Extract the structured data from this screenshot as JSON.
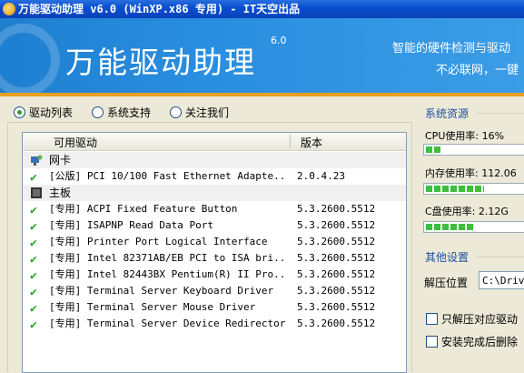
{
  "window": {
    "title": "万能驱动助理 v6.0 (WinXP.x86 专用) - IT天空出品"
  },
  "banner": {
    "product_name": "万能驱动助理",
    "version": "6.0",
    "slogan_line1": "智能的硬件检测与驱动",
    "slogan_line2": "不必联网，一键"
  },
  "tabs": [
    {
      "label": "驱动列表",
      "selected": true
    },
    {
      "label": "系统支持",
      "selected": false
    },
    {
      "label": "关注我们",
      "selected": false
    }
  ],
  "driver_list": {
    "columns": [
      "可用驱动",
      "版本"
    ],
    "rows": [
      {
        "type": "category",
        "icon": "network-card-icon",
        "name": "网卡",
        "version": ""
      },
      {
        "type": "driver",
        "icon": "check-icon",
        "name": "[公版] PCI 10/100 Fast Ethernet Adapte...",
        "version": "2.0.4.23"
      },
      {
        "type": "category",
        "icon": "motherboard-icon",
        "name": "主板",
        "version": ""
      },
      {
        "type": "driver",
        "icon": "check-icon",
        "name": "[专用] ACPI Fixed Feature Button",
        "version": "5.3.2600.5512"
      },
      {
        "type": "driver",
        "icon": "check-icon",
        "name": "[专用] ISAPNP Read Data Port",
        "version": "5.3.2600.5512"
      },
      {
        "type": "driver",
        "icon": "check-icon",
        "name": "[专用] Printer Port Logical Interface",
        "version": "5.3.2600.5512"
      },
      {
        "type": "driver",
        "icon": "check-icon",
        "name": "[专用] Intel 82371AB/EB PCI to ISA bri...",
        "version": "5.3.2600.5512"
      },
      {
        "type": "driver",
        "icon": "check-icon",
        "name": "[专用] Intel 82443BX Pentium(R) II Pro...",
        "version": "5.3.2600.5512"
      },
      {
        "type": "driver",
        "icon": "check-icon",
        "name": "[专用] Terminal Server Keyboard Driver",
        "version": "5.3.2600.5512"
      },
      {
        "type": "driver",
        "icon": "check-icon",
        "name": "[专用] Terminal Server Mouse Driver",
        "version": "5.3.2600.5512"
      },
      {
        "type": "driver",
        "icon": "check-icon",
        "name": "[专用] Terminal Server Device Redirector",
        "version": "5.3.2600.5512"
      }
    ]
  },
  "system_resources": {
    "title": "系统资源",
    "cpu": {
      "label": "CPU使用率:  16%",
      "percent": 16
    },
    "memory": {
      "label": "内存使用率: 112.06",
      "percent": 60
    },
    "disk": {
      "label": "C盘使用率:  2.12G",
      "percent": 50
    }
  },
  "other_settings": {
    "title": "其他设置",
    "extract_label": "解压位置",
    "extract_value": "C:\\Drive",
    "option1": "只解压对应驱动",
    "option2": "安装完成后删除"
  },
  "colors": {
    "banner": "#2a8ee0",
    "titlebar": "#0a4fd0",
    "accent_line": "#e8a020",
    "progress": "#3cc03c",
    "section_title": "#1c4e9c"
  }
}
